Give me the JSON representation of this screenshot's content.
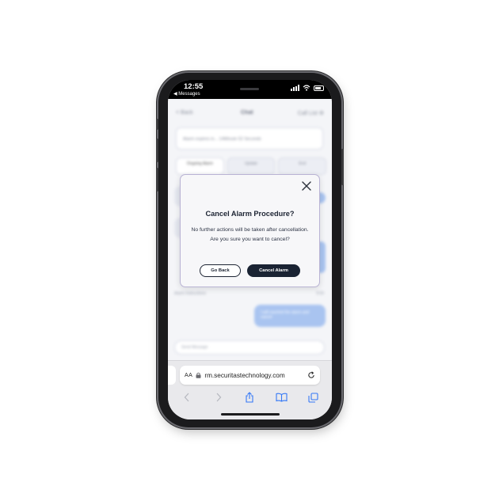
{
  "status_bar": {
    "time": "12:55",
    "back_app": "◀ Messages"
  },
  "chat_background": {
    "nav_back": "< Back",
    "nav_title": "Chat",
    "nav_action": "Call List ⚙",
    "search_text": "Alarm expires in... 14Minute 52 Seconds",
    "pills": [
      "Ongoing Alarm",
      "Update",
      "End"
    ],
    "meta_left": "Alarm Instructions",
    "meta_right": "9:00",
    "message_text": "I will reached the alarm and cancel",
    "input_placeholder": "Send Message"
  },
  "modal": {
    "title": "Cancel Alarm Procedure?",
    "body": "No further actions will be taken after cancellation. Are you sure you want to cancel?",
    "go_back_label": "Go Back",
    "cancel_alarm_label": "Cancel Alarm"
  },
  "safari": {
    "aa_label": "AA",
    "url": "rm.securitastechnology.com"
  },
  "colors": {
    "modal_border": "#b9b3d4",
    "primary_button": "#1a2333",
    "browser_icon_blue": "#3478f6"
  },
  "icons": [
    "close-icon",
    "lock-icon",
    "reload-icon",
    "back-arrow-icon",
    "forward-arrow-icon",
    "share-icon",
    "bookmarks-icon",
    "tabs-icon",
    "wifi-icon",
    "battery-icon",
    "signal-icon"
  ]
}
